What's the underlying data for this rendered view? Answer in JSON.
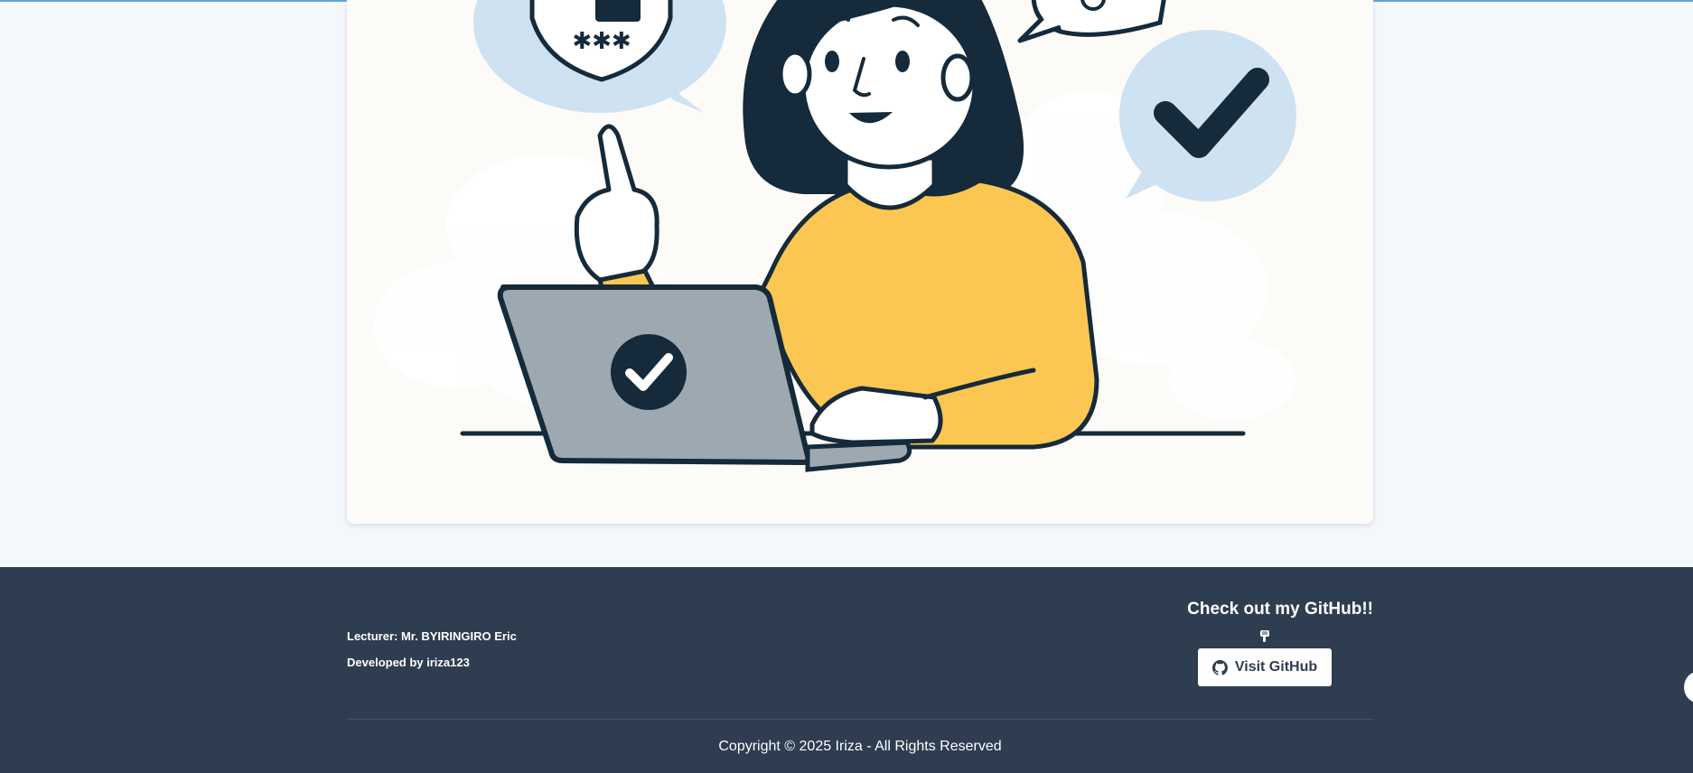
{
  "footer": {
    "lecturer": "Lecturer: Mr. BYIRINGIRO Eric",
    "developer": "Developed by iriza123",
    "github_heading": "Check out my GitHub!!",
    "github_button": "Visit GitHub",
    "copyright": "Copyright © 2025 Iriza - All Rights Reserved"
  },
  "icons": {
    "github": "github-icon",
    "emoji": "pointing-down-emoji"
  },
  "colors": {
    "page_bg": "#f4f7fc",
    "footer_bg": "#2e3d50",
    "illustration_sweater": "#fcc652",
    "illustration_bubble": "#cfe2f2",
    "illustration_laptop": "#9ea8b0",
    "illustration_outline": "#152a3a"
  }
}
